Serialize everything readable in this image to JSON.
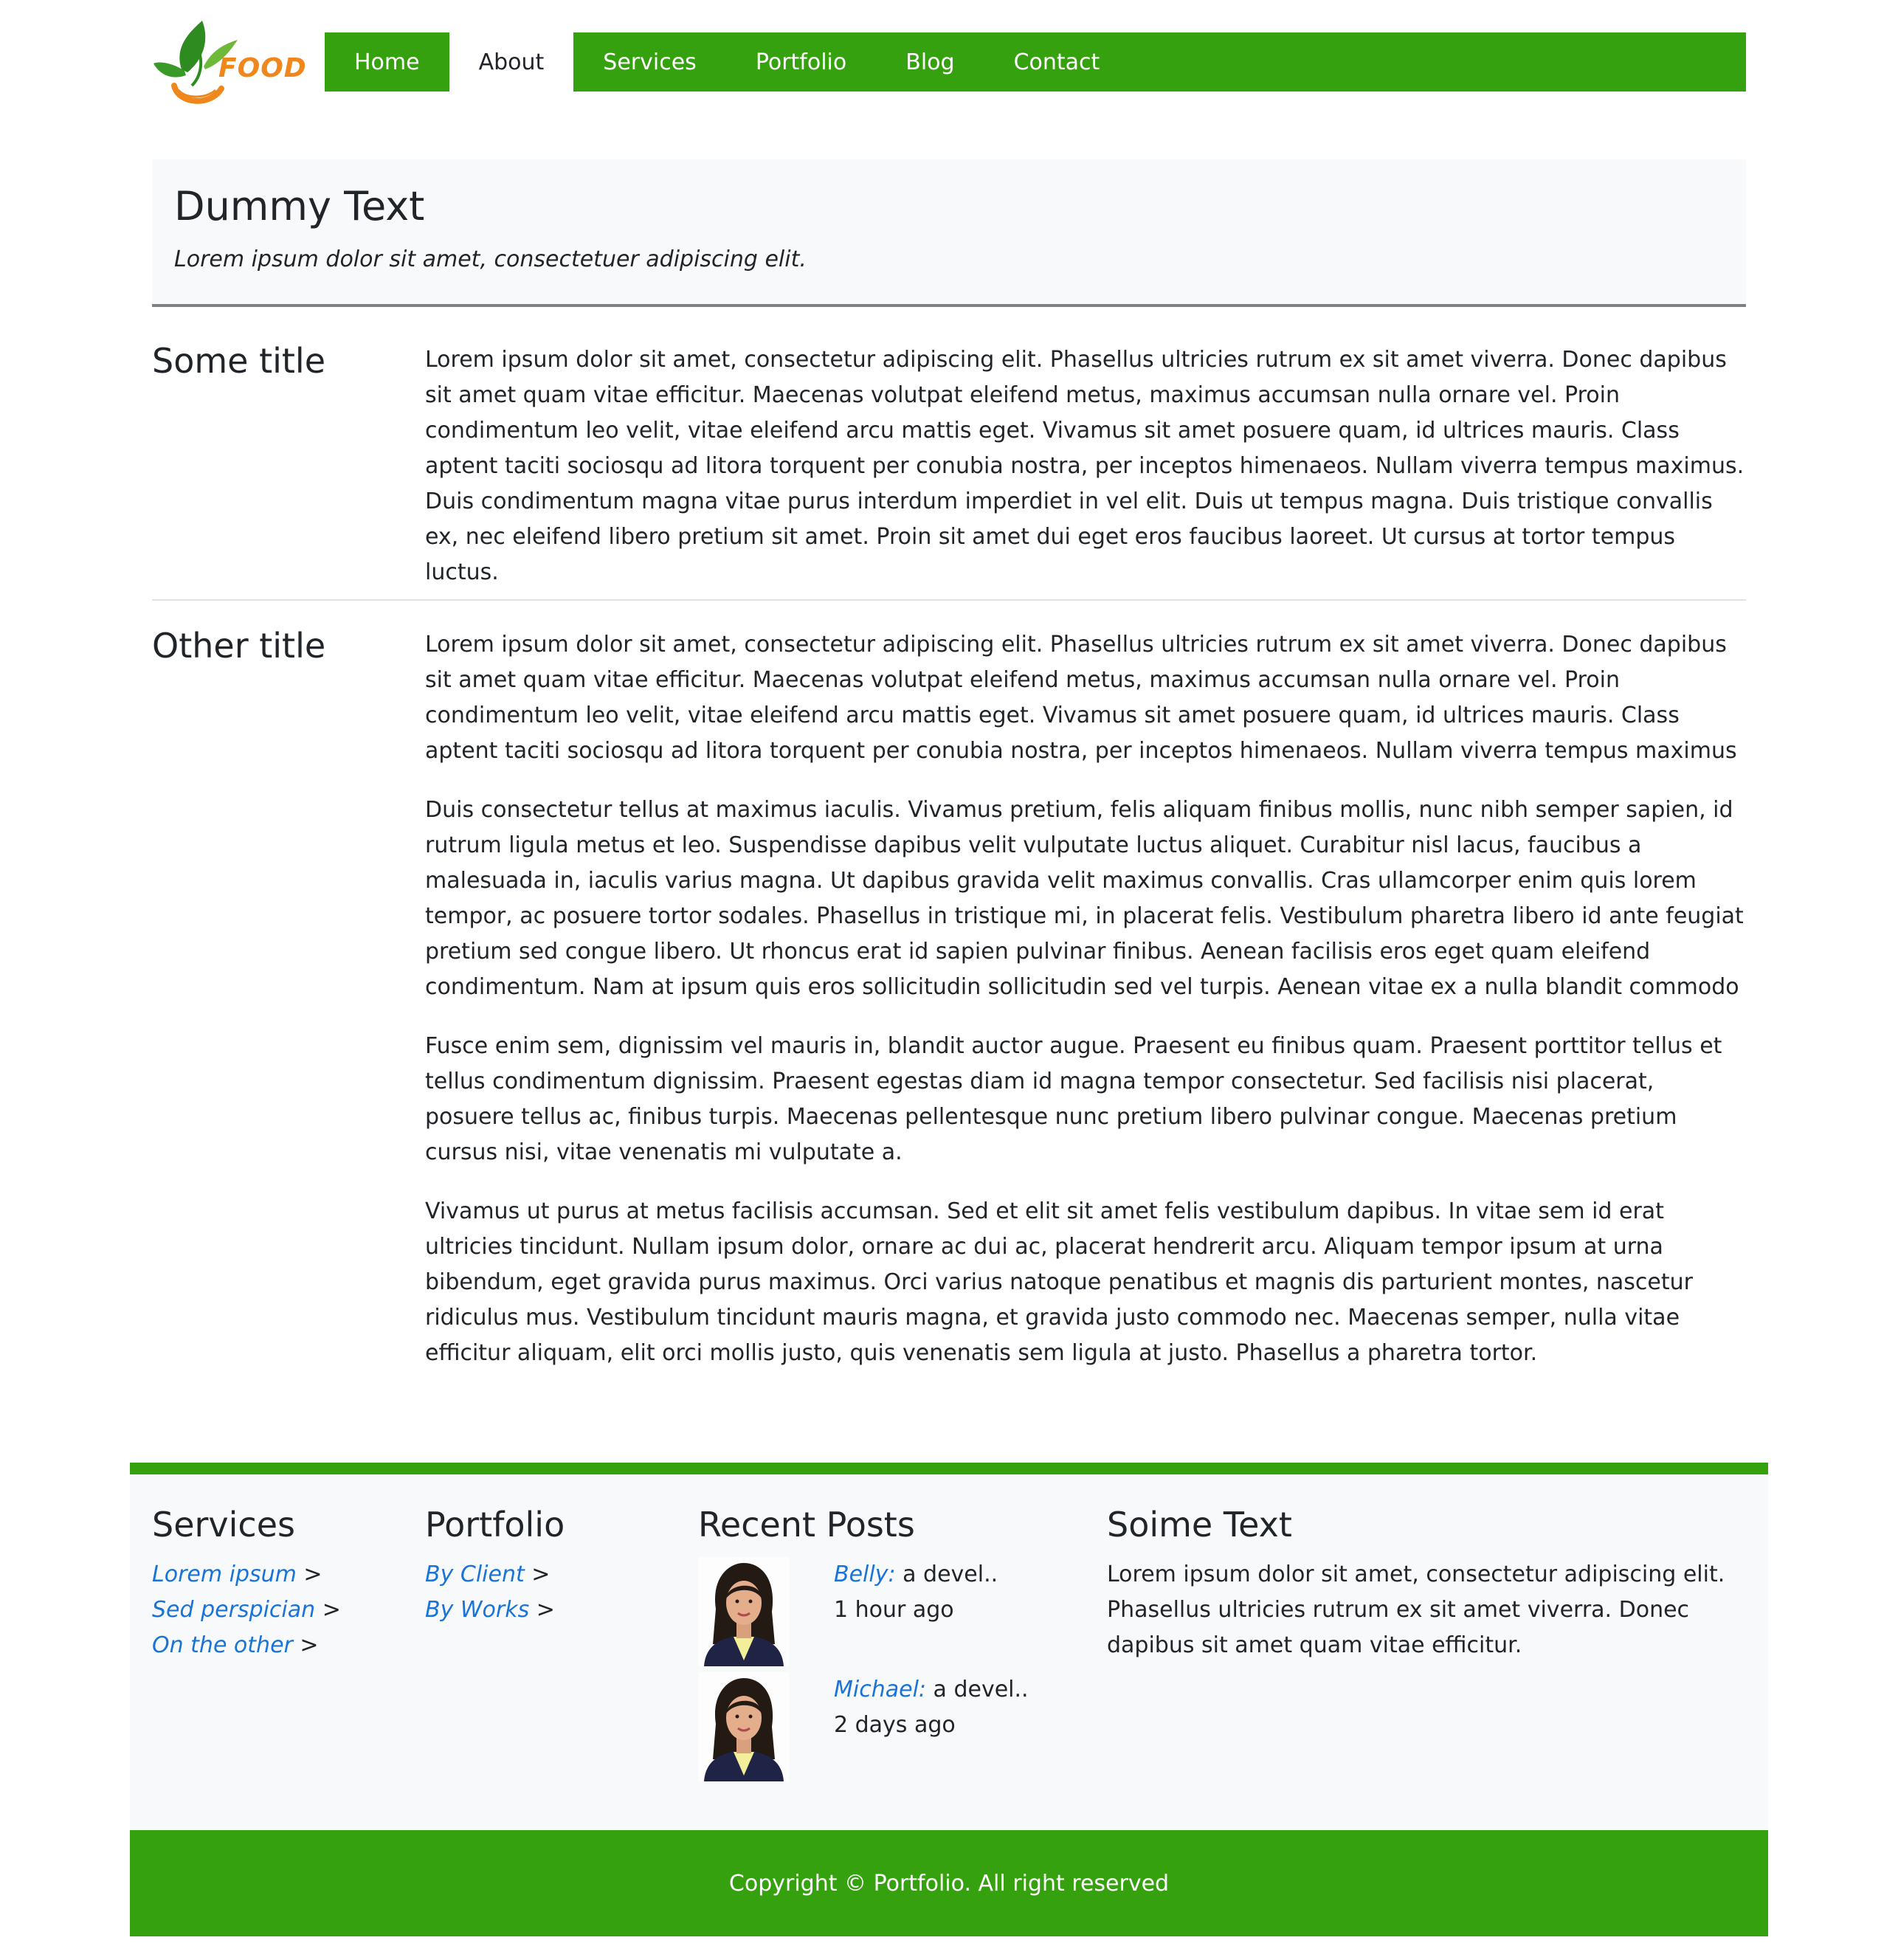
{
  "brand": {
    "logo_text": "FOOD",
    "accent": "#36a10e",
    "logo_orange": "#f0871c"
  },
  "nav": {
    "items": [
      {
        "label": "Home"
      },
      {
        "label": "About"
      },
      {
        "label": "Services"
      },
      {
        "label": "Portfolio"
      },
      {
        "label": "Blog"
      },
      {
        "label": "Contact"
      }
    ],
    "active": "About"
  },
  "jumbotron": {
    "title": "Dummy Text",
    "subtitle": "Lorem ipsum dolor sit amet, consectetuer adipiscing elit."
  },
  "sections": [
    {
      "title": "Some title",
      "paragraphs": [
        "Lorem ipsum dolor sit amet, consectetur adipiscing elit. Phasellus ultricies rutrum ex sit amet viverra. Donec dapibus sit amet quam vitae efficitur. Maecenas volutpat eleifend metus, maximus accumsan nulla ornare vel. Proin condimentum leo velit, vitae eleifend arcu mattis eget. Vivamus sit amet posuere quam, id ultrices mauris. Class aptent taciti sociosqu ad litora torquent per conubia nostra, per inceptos himenaeos. Nullam viverra tempus maximus. Duis condimentum magna vitae purus interdum imperdiet in vel elit. Duis ut tempus magna. Duis tristique convallis ex, nec eleifend libero pretium sit amet. Proin sit amet dui eget eros faucibus laoreet. Ut cursus at tortor tempus luctus."
      ]
    },
    {
      "title": "Other title",
      "paragraphs": [
        "Lorem ipsum dolor sit amet, consectetur adipiscing elit. Phasellus ultricies rutrum ex sit amet viverra. Donec dapibus sit amet quam vitae efficitur. Maecenas volutpat eleifend metus, maximus accumsan nulla ornare vel. Proin condimentum leo velit, vitae eleifend arcu mattis eget. Vivamus sit amet posuere quam, id ultrices mauris. Class aptent taciti sociosqu ad litora torquent per conubia nostra, per inceptos himenaeos. Nullam viverra tempus maximus",
        "Duis consectetur tellus at maximus iaculis. Vivamus pretium, felis aliquam finibus mollis, nunc nibh semper sapien, id rutrum ligula metus et leo. Suspendisse dapibus velit vulputate luctus aliquet. Curabitur nisl lacus, faucibus a malesuada in, iaculis varius magna. Ut dapibus gravida velit maximus convallis. Cras ullamcorper enim quis lorem tempor, ac posuere tortor sodales. Phasellus in tristique mi, in placerat felis. Vestibulum pharetra libero id ante feugiat pretium sed congue libero. Ut rhoncus erat id sapien pulvinar finibus. Aenean facilisis eros eget quam eleifend condimentum. Nam at ipsum quis eros sollicitudin sollicitudin sed vel turpis. Aenean vitae ex a nulla blandit commodo",
        "Fusce enim sem, dignissim vel mauris in, blandit auctor augue. Praesent eu finibus quam. Praesent porttitor tellus et tellus condimentum dignissim. Praesent egestas diam id magna tempor consectetur. Sed facilisis nisi placerat, posuere tellus ac, finibus turpis. Maecenas pellentesque nunc pretium libero pulvinar congue. Maecenas pretium cursus nisi, vitae venenatis mi vulputate a.",
        "Vivamus ut purus at metus facilisis accumsan. Sed et elit sit amet felis vestibulum dapibus. In vitae sem id erat ultricies tincidunt. Nullam ipsum dolor, ornare ac dui ac, placerat hendrerit arcu. Aliquam tempor ipsum at urna bibendum, eget gravida purus maximus. Orci varius natoque penatibus et magnis dis parturient montes, nascetur ridiculus mus. Vestibulum tincidunt mauris magna, et gravida justo commodo nec. Maecenas semper, nulla vitae efficitur aliquam, elit orci mollis justo, quis venenatis sem ligula at justo. Phasellus a pharetra tortor."
      ]
    }
  ],
  "footer": {
    "services": {
      "title": "Services",
      "links": [
        {
          "label": "Lorem ipsum",
          "suffix": ">"
        },
        {
          "label": "Sed perspician",
          "suffix": ">"
        },
        {
          "label": "On the other",
          "suffix": ">"
        }
      ]
    },
    "portfolio": {
      "title": "Portfolio",
      "links": [
        {
          "label": "By Client",
          "suffix": ">"
        },
        {
          "label": "By Works",
          "suffix": ">"
        }
      ]
    },
    "recent_posts": {
      "title": "Recent Posts",
      "posts": [
        {
          "author": "Belly:",
          "excerpt": " a devel..",
          "time": "1 hour ago"
        },
        {
          "author": "Michael:",
          "excerpt": " a devel..",
          "time": "2 days ago"
        }
      ]
    },
    "some_text": {
      "title": "Soime Text",
      "body": "Lorem ipsum dolor sit amet, consectetur adipiscing elit. Phasellus ultricies rutrum ex sit amet viverra. Donec dapibus sit amet quam vitae efficitur."
    },
    "copyright": "Copyright © Portfolio. All right reserved"
  }
}
